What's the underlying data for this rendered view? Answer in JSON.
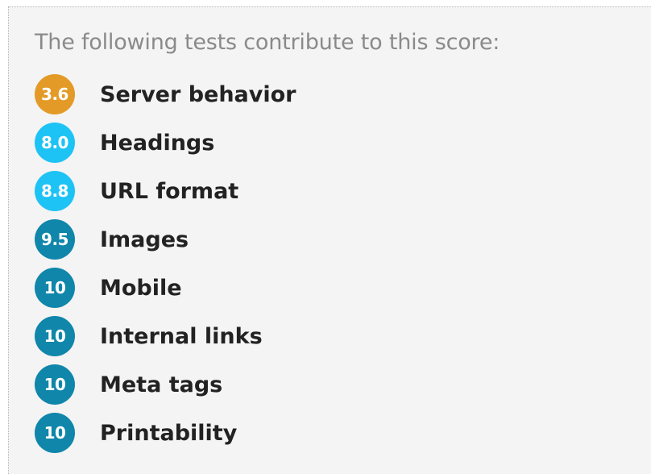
{
  "intro": "The following tests contribute to this score:",
  "tests": [
    {
      "score": "3.6",
      "label": "Server behavior",
      "color": "#e39a26"
    },
    {
      "score": "8.0",
      "label": "Headings",
      "color": "#1ec3f5"
    },
    {
      "score": "8.8",
      "label": "URL format",
      "color": "#1ec3f5"
    },
    {
      "score": "9.5",
      "label": "Images",
      "color": "#0f86aa"
    },
    {
      "score": "10",
      "label": "Mobile",
      "color": "#0f86aa"
    },
    {
      "score": "10",
      "label": "Internal links",
      "color": "#0f86aa"
    },
    {
      "score": "10",
      "label": "Meta tags",
      "color": "#0f86aa"
    },
    {
      "score": "10",
      "label": "Printability",
      "color": "#0f86aa"
    }
  ]
}
